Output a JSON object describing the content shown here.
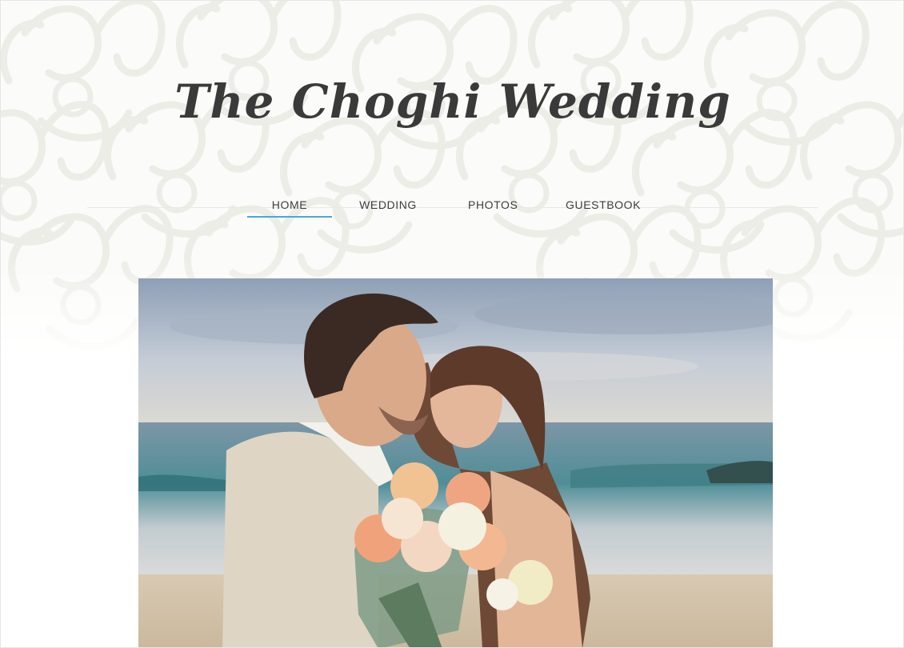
{
  "site": {
    "title": "The Choghi Wedding"
  },
  "nav": {
    "items": [
      {
        "label": "HOME",
        "active": true
      },
      {
        "label": "WEDDING",
        "active": false
      },
      {
        "label": "PHOTOS",
        "active": false
      },
      {
        "label": "GUESTBOOK",
        "active": false
      }
    ]
  },
  "colors": {
    "accent": "#4ba9d3",
    "text": "#3a3a3a",
    "damask": "#eeeee8"
  },
  "hero": {
    "image": "couple-beach-photo"
  }
}
